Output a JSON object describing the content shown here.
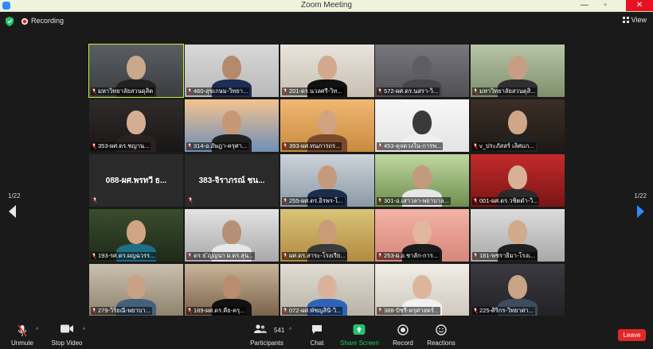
{
  "window": {
    "title": "Zoom Meeting",
    "min": "—",
    "max": "▫",
    "close": "✕"
  },
  "topbar": {
    "recording": "Recording",
    "view": "View"
  },
  "gallery": {
    "page_left": "1/22",
    "page_right": "1/22",
    "tiles": [
      {
        "name": "มหาวิทยาลัยสวนดุสิต",
        "big": ""
      },
      {
        "name": "460-สุขเกษม-วิทยา...",
        "big": ""
      },
      {
        "name": "201-ดร.นวลศรี-วิท...",
        "big": ""
      },
      {
        "name": "572-ผศ.ดร.นสรา-วิ...",
        "big": ""
      },
      {
        "name": "มหาวิทยาลัยสวนดุสิ...",
        "big": ""
      },
      {
        "name": "353-ผศ.ดร.ชญาน...",
        "big": ""
      },
      {
        "name": "314-อ.อัษฎา-ครุศา...",
        "big": ""
      },
      {
        "name": "393-ผศ.ทนภารถร...",
        "big": ""
      },
      {
        "name": "453-ดุจดวงใน-การพ...",
        "big": ""
      },
      {
        "name": "v_ประภัสสร์ เลิศแก...",
        "big": ""
      },
      {
        "name": "",
        "big": "088-ผศ.พรทวี ธ..."
      },
      {
        "name": "",
        "big": "383-จิราภรณ์ ชน..."
      },
      {
        "name": "255-ผศ.ดร.อิรพร-โ...",
        "big": ""
      },
      {
        "name": "301-อ.เสาวลา-พยาบาล...",
        "big": ""
      },
      {
        "name": "001-ผศ.ดร.วชิตดำ-วิ...",
        "big": ""
      },
      {
        "name": "193-รศ.ดร.ผญฉวรร...",
        "big": ""
      },
      {
        "name": "ดร.ธ.ัญญนา ผ.ดร.สุน...",
        "big": ""
      },
      {
        "name": "ผศ.ดร.สาระ-โรงเรีย...",
        "big": ""
      },
      {
        "name": "253-ผ.อ.ชาลัก-การ...",
        "big": ""
      },
      {
        "name": "181-พชราธิมา-โรงเ...",
        "big": ""
      },
      {
        "name": "279-วิริยณี-พยาบา...",
        "big": ""
      },
      {
        "name": "189-ผศ.ดร.คีย-ครุ...",
        "big": ""
      },
      {
        "name": "072-ผศ.พัชญสินี-วิ...",
        "big": ""
      },
      {
        "name": "388-ปัชรี-ครุศาสตร์...",
        "big": ""
      },
      {
        "name": "225-ศิริกร-วิทยาศา...",
        "big": ""
      }
    ]
  },
  "toolbar": {
    "unmute": "Unmute",
    "stop_video": "Stop Video",
    "participants": "Participants",
    "participants_count": "541",
    "chat": "Chat",
    "share_screen": "Share Screen",
    "record": "Record",
    "reactions": "Reactions",
    "leave": "Leave"
  },
  "colors": {
    "accent_green": "#23c36b",
    "active_outline": "#c9ef3c",
    "leave_red": "#e02828",
    "arrow_blue": "#2d8cff"
  }
}
